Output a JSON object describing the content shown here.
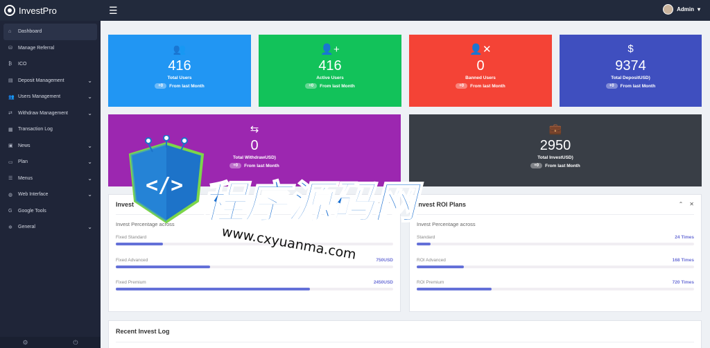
{
  "app": {
    "name": "InvestPro"
  },
  "header": {
    "admin_label": "Admin"
  },
  "sidebar": {
    "items": [
      {
        "label": "Dashboard",
        "icon": "home-icon",
        "glyph": "⌂",
        "arrow": false,
        "active": true
      },
      {
        "label": "Manage Referral",
        "icon": "sitemap-icon",
        "glyph": "⛁",
        "arrow": false
      },
      {
        "label": "ICO",
        "icon": "bitcoin-icon",
        "glyph": "₿",
        "arrow": false
      },
      {
        "label": "Deposit Management",
        "icon": "deposit-icon",
        "glyph": "▤",
        "arrow": true
      },
      {
        "label": "Users Management",
        "icon": "users-icon",
        "glyph": "👥",
        "arrow": true
      },
      {
        "label": "Withdraw Management",
        "icon": "exchange-icon",
        "glyph": "⇄",
        "arrow": true
      },
      {
        "label": "Transaction Log",
        "icon": "list-icon",
        "glyph": "▦",
        "arrow": false
      },
      {
        "label": "News",
        "icon": "newspaper-icon",
        "glyph": "▣",
        "arrow": true
      },
      {
        "label": "Plan",
        "icon": "folder-icon",
        "glyph": "▭",
        "arrow": true
      },
      {
        "label": "Menus",
        "icon": "menu-icon",
        "glyph": "☰",
        "arrow": true
      },
      {
        "label": "Web Interface",
        "icon": "globe-icon",
        "glyph": "◍",
        "arrow": true
      },
      {
        "label": "Google Tools",
        "icon": "google-icon",
        "glyph": "G",
        "arrow": false
      },
      {
        "label": "General",
        "icon": "gear-icon",
        "glyph": "✲",
        "arrow": true
      }
    ]
  },
  "stats": [
    {
      "value": "416",
      "label": "Total Users",
      "change": "+0",
      "foot": "From last Month",
      "color": "#2196f3",
      "icon": "users-icon",
      "glyph": "👥"
    },
    {
      "value": "416",
      "label": "Active Users",
      "change": "+0",
      "foot": "From last Month",
      "color": "#12c25a",
      "icon": "user-plus-icon",
      "glyph": "👤+"
    },
    {
      "value": "0",
      "label": "Banned Users",
      "change": "+0",
      "foot": "From last Month",
      "color": "#f44336",
      "icon": "user-times-icon",
      "glyph": "👤✕"
    },
    {
      "value": "9374",
      "label": "Total DepositUSD)",
      "change": "+0",
      "foot": "From last Month",
      "color": "#3f4fbf",
      "icon": "money-bill-icon",
      "glyph": "$"
    },
    {
      "value": "0",
      "label": "Total WithdrawUSD)",
      "change": "+0",
      "foot": "From last Month",
      "color": "#9c27b0",
      "icon": "retweet-icon",
      "glyph": "⇆"
    },
    {
      "value": "2950",
      "label": "Total InvestUSD)",
      "change": "+0",
      "foot": "From last Month",
      "color": "#393e46",
      "icon": "briefcase-icon",
      "glyph": "💼"
    }
  ],
  "invest_panel": {
    "title": "Invest",
    "subtitle": "Invest Percentage across",
    "rows": [
      {
        "label": "Fixed Standard",
        "value": "",
        "percent": 17
      },
      {
        "label": "Fixed Advanced",
        "value": "750USD",
        "percent": 34
      },
      {
        "label": "Fixed Premium",
        "value": "2450USD",
        "percent": 70
      }
    ]
  },
  "roi_panel": {
    "title": "Invest ROI Plans",
    "subtitle": "Invest Percentage across",
    "rows": [
      {
        "label": "Standard",
        "value": "24 Times",
        "percent": 5
      },
      {
        "label": "ROI Advanced",
        "value": "168 Times",
        "percent": 17
      },
      {
        "label": "ROI Premium",
        "value": "720 Times",
        "percent": 27
      }
    ]
  },
  "recent_log": {
    "title": "Recent Invest Log"
  },
  "watermark": {
    "text_cn": "程序源码网",
    "url": "www.cxyuanma.com"
  }
}
